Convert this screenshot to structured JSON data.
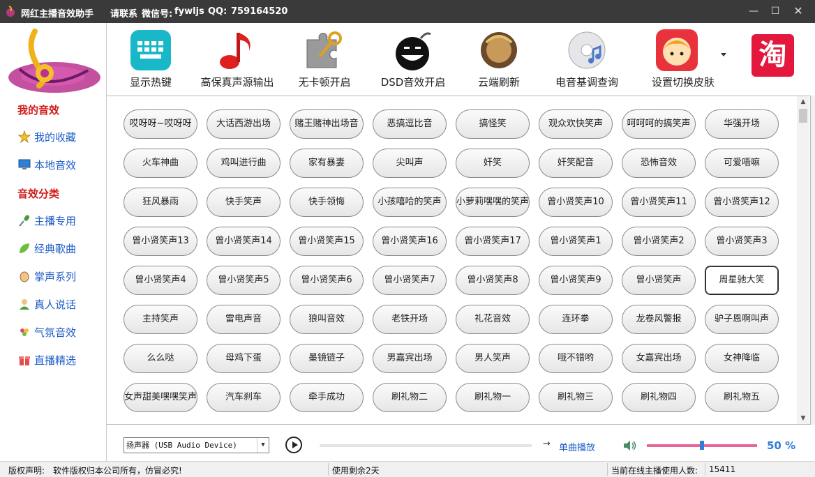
{
  "title_bar": {
    "app_title": "网红主播音效助手",
    "contact_label": "请联系",
    "wechat_label": "微信号:",
    "wechat_value": "fywljs",
    "qq_label": "QQ:",
    "qq_value": "759164520"
  },
  "window_controls": {
    "minimize": "—",
    "maximize": "☐",
    "close": "✕"
  },
  "sidebar": {
    "section_my": "我的音效",
    "my_items": [
      {
        "label": "我的收藏",
        "icon": "star-icon"
      },
      {
        "label": "本地音效",
        "icon": "monitor-icon"
      }
    ],
    "section_categories": "音效分类",
    "category_items": [
      {
        "label": "主播专用",
        "icon": "microphone-icon"
      },
      {
        "label": "经典歌曲",
        "icon": "leaf-icon"
      },
      {
        "label": "掌声系列",
        "icon": "clap-icon"
      },
      {
        "label": "真人说话",
        "icon": "person-icon"
      },
      {
        "label": "气氛音效",
        "icon": "flower-icon"
      },
      {
        "label": "直播精选",
        "icon": "gift-icon"
      }
    ]
  },
  "toolbar": {
    "items": [
      {
        "label": "显示热键",
        "icon": "keyboard-icon"
      },
      {
        "label": "高保真声源输出",
        "icon": "music-note-icon"
      },
      {
        "label": "无卡顿开启",
        "icon": "puzzle-key-icon"
      },
      {
        "label": "DSD音效开启",
        "icon": "bomb-icon"
      },
      {
        "label": "云端刷新",
        "icon": "warrior-avatar-icon"
      },
      {
        "label": "电音基调查询",
        "icon": "cd-music-icon"
      },
      {
        "label": "设置切换皮肤",
        "icon": "anime-girl-icon"
      }
    ],
    "taobao_text": "淘"
  },
  "sounds": [
    "哎呀呀~哎呀呀",
    "大话西游出场",
    "赌王赌神出场音",
    "恶搞逗比音",
    "搞怪笑",
    "观众欢快笑声",
    "呵呵呵的搞笑声",
    "华强开场",
    "火车神曲",
    "鸡叫进行曲",
    "家有暴妻",
    "尖叫声",
    "奸笑",
    "奸笑配音",
    "恐怖音效",
    "可爱唔嘛",
    "狂风暴雨",
    "快手笑声",
    "快手领悔",
    "小孩嘻哈的笑声",
    "小萝莉嘿嘿的笑声",
    "曾小贤笑声10",
    "曾小贤笑声11",
    "曾小贤笑声12",
    "曾小贤笑声13",
    "曾小贤笑声14",
    "曾小贤笑声15",
    "曾小贤笑声16",
    "曾小贤笑声17",
    "曾小贤笑声1",
    "曾小贤笑声2",
    "曾小贤笑声3",
    "曾小贤笑声4",
    "曾小贤笑声5",
    "曾小贤笑声6",
    "曾小贤笑声7",
    "曾小贤笑声8",
    "曾小贤笑声9",
    "曾小贤笑声",
    "周星驰大笑",
    "主持笑声",
    "雷电声音",
    "狼叫音效",
    "老铁开场",
    "礼花音效",
    "连环拳",
    "龙卷风警报",
    "驴子恩啊叫声",
    "么么哒",
    "母鸡下蛋",
    "墨镜链子",
    "男嘉宾出场",
    "男人笑声",
    "哦不错哟",
    "女嘉宾出场",
    "女神降临",
    "女声甜美嘿嘿笑声",
    "汽车刹车",
    "牵手成功",
    "刷礼物二",
    "刷礼物一",
    "刷礼物三",
    "刷礼物四",
    "刷礼物五"
  ],
  "selected_sound": "周星驰大笑",
  "player": {
    "device": "扬声器 (USB Audio Device)",
    "mode_label": "单曲播放",
    "volume_percent": 50,
    "volume_text": "50 %",
    "progress_percent": 0
  },
  "status_bar": {
    "copyright_label": "版权声明:",
    "copyright_text": "软件版权归本公司所有，仿冒必究!",
    "remaining": "使用剩余2天",
    "online_label": "当前在线主播使用人数:",
    "online_count": "15411"
  },
  "colors": {
    "section_red": "#d11b1b",
    "link_blue": "#1c5cc7",
    "volume_pink": "#e6669a",
    "volume_blue": "#2f7fd6",
    "titlebar": "#3a3a3a"
  }
}
